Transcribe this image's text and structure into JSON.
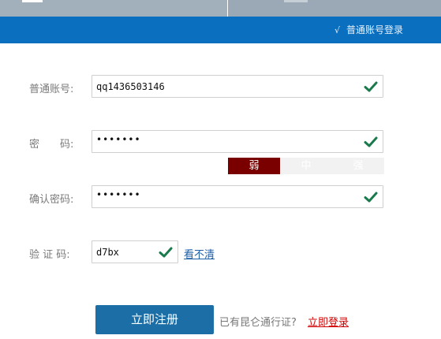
{
  "header": {
    "mode_toggle_label": "普通账号登录",
    "mode_toggle_icon": "check-mark-icon"
  },
  "form": {
    "account": {
      "label": "普通账号:",
      "value": "qq1436503146"
    },
    "password": {
      "label": "密　　码:",
      "value": "•••••••"
    },
    "strength": {
      "weak": "弱",
      "medium": "中",
      "strong": "强",
      "level": "weak",
      "weak_color": "#7a0000"
    },
    "confirm": {
      "label": "确认密码:",
      "value": "•••••••"
    },
    "captcha": {
      "label": "验 证 码:",
      "value": "d7bx",
      "refresh_link": "看不清"
    }
  },
  "actions": {
    "register_button": "立即注册",
    "have_account_text": "已有昆仑通行证?",
    "login_link": "立即登录"
  },
  "colors": {
    "header_blue": "#0b6fc0",
    "button_blue": "#1b6fa6",
    "check_green": "#1a7a4c",
    "link_red": "#d20000"
  }
}
